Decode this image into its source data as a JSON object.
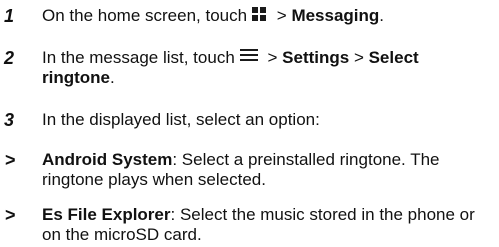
{
  "steps": [
    {
      "number": "1",
      "text_before": "On the home screen, touch",
      "icon": "apps-grid-icon",
      "text_mid": " > ",
      "bold": "Messaging",
      "text_after": "."
    },
    {
      "number": "2",
      "text_before": "In the message list, touch",
      "icon": "menu-icon",
      "text_mid": " > ",
      "bold1": "Settings",
      "sep": " > ",
      "bold2": "Select ringtone",
      "text_after": "."
    },
    {
      "number": "3",
      "text": "In the displayed list, select an option:"
    }
  ],
  "options": [
    {
      "marker": ">",
      "name": "Android System",
      "description": ": Select a preinstalled ringtone. The ringtone plays when selected."
    },
    {
      "marker": ">",
      "name": "Es File Explorer",
      "description": ": Select the music stored in the phone or on the microSD card."
    }
  ]
}
